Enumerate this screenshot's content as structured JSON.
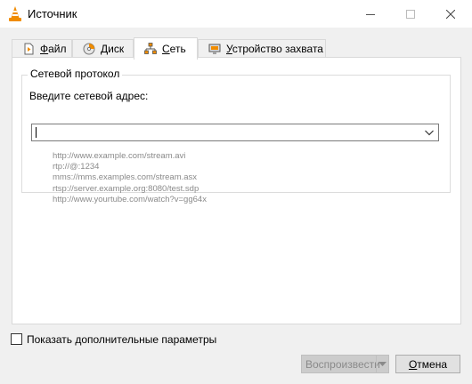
{
  "window": {
    "title": "Источник"
  },
  "tabs": [
    {
      "label": "Файл",
      "mnemonic": "Ф",
      "rest": "айл",
      "icon": "file-icon"
    },
    {
      "label": "Диск",
      "mnemonic": "Д",
      "rest": "иск",
      "icon": "disc-icon"
    },
    {
      "label": "Сеть",
      "mnemonic": "С",
      "rest": "еть",
      "icon": "network-icon",
      "active": true
    },
    {
      "label": "Устройство захвата",
      "mnemonic": "У",
      "rest": "стройство захвата",
      "icon": "capture-device-icon"
    }
  ],
  "network": {
    "group_title": "Сетевой протокол",
    "address_label": "Введите сетевой адрес:",
    "address_value": "",
    "examples": [
      "http://www.example.com/stream.avi",
      "rtp://@:1234",
      "mms://mms.examples.com/stream.asx",
      "rtsp://server.example.org:8080/test.sdp",
      "http://www.yourtube.com/watch?v=gg64x"
    ]
  },
  "options": {
    "show_more_label": "Показать дополнительные параметры",
    "checked": false
  },
  "buttons": {
    "play_label": "Воспроизвести",
    "cancel_label": "Отмена",
    "cancel_mnemonic": "О",
    "cancel_rest": "тмена"
  },
  "colors": {
    "accent_orange": "#f08c00",
    "disabled_text": "#8a8a8a"
  }
}
